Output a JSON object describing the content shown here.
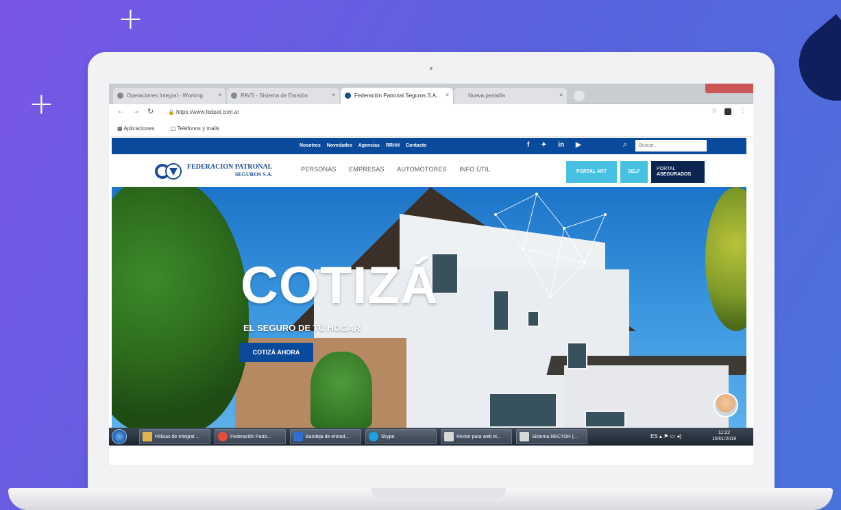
{
  "browser": {
    "tabs": [
      {
        "label": "Operaciones Integral - Workmg",
        "active": false
      },
      {
        "label": "PAVS - Sistema de Emisión",
        "active": false
      },
      {
        "label": "Federación Patronal Seguros S.A.",
        "active": true
      },
      {
        "label": "Nueva pestaña",
        "active": false
      }
    ],
    "url": "https://www.fedpat.com.ar",
    "bookmarks": [
      "Aplicaciones",
      "Teléfonos y mails"
    ]
  },
  "site": {
    "toplinks": [
      "Nosotros",
      "Novedades",
      "Agencias",
      "RRHH",
      "Contacto"
    ],
    "social": [
      "f",
      "t",
      "in",
      "yt"
    ],
    "search_placeholder": "Buscar...",
    "logo": {
      "line1": "FEDERACION PATRONAL",
      "line2": "SEGUROS S.A."
    },
    "nav": [
      "PERSONAS",
      "EMPRESAS",
      "AUTOMOTORES",
      "INFO ÚTIL"
    ],
    "buttons": {
      "portal_art": "PORTAL ART",
      "self": "SELF",
      "portal_asegurados_1": "PORTAL",
      "portal_asegurados_2": "ASEGURADOS"
    },
    "hero": {
      "title": "COTIZÁ",
      "subtitle": "EL SEGURO DE TU HOGAR",
      "cta": "COTIZÁ AHORA"
    }
  },
  "taskbar": {
    "items": [
      {
        "label": "Pólizas de Integral ...",
        "icon_color": "#e3b54a"
      },
      {
        "label": "Federación Patro...",
        "icon_color": "#e84c3d"
      },
      {
        "label": "Bandeja de entrad...",
        "icon_color": "#2f6fcf"
      },
      {
        "label": "Skype",
        "icon_color": "#1ea0e6"
      },
      {
        "label": "Rector para web el...",
        "icon_color": "#d8d8d8"
      },
      {
        "label": "Sistema RECTOR (...",
        "icon_color": "#d8d8d8"
      }
    ],
    "time": "11:22",
    "date": "15/01/2019"
  },
  "colors": {
    "brand_blue": "#0a4a9c",
    "portal_cyan": "#46c1e1",
    "asegurados_navy": "#0c2550"
  }
}
